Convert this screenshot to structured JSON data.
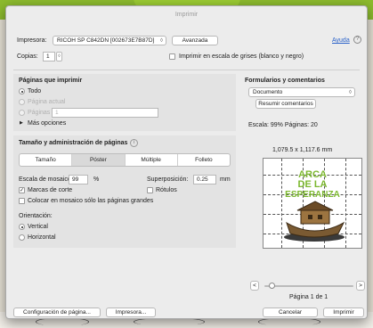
{
  "window": {
    "title": "Imprimir"
  },
  "printer": {
    "label": "Impresora:",
    "value": "RICOH SP C842DN [002673E7B87D]",
    "advanced_label": "Avanzada",
    "help_label": "Ayuda"
  },
  "copies": {
    "label": "Copias:",
    "value": "1",
    "grayscale_label": "Imprimir en escala de grises (blanco y negro)"
  },
  "pages": {
    "title": "Páginas que imprimir",
    "all_label": "Todo",
    "current_label": "Página actual",
    "range_label": "Páginas",
    "range_value": "1",
    "more_label": "Más opciones"
  },
  "forms": {
    "title": "Formularios y comentarios",
    "select_value": "Documento",
    "summary_button": "Resumir comentarios"
  },
  "scale_info": {
    "text": "Escala:  99%  Páginas: 20"
  },
  "size": {
    "title": "Tamaño y administración de páginas",
    "tabs": [
      "Tamaño",
      "Póster",
      "Múltiple",
      "Folleto"
    ],
    "active_tab": "Póster",
    "tile_scale_label": "Escala de mosaico:",
    "tile_scale_value": "99",
    "tile_scale_unit": "%",
    "overlap_label": "Superposición:",
    "overlap_value": "0.25",
    "overlap_unit": "mm",
    "cut_marks_label": "Marcas de corte",
    "labels_label": "Rótulos",
    "large_pages_label": "Colocar en mosaico sólo las páginas grandes"
  },
  "orientation": {
    "title": "Orientación:",
    "vertical_label": "Vertical",
    "horizontal_label": "Horizontal"
  },
  "preview": {
    "dimensions": "1,079.5 x 1,117.6 mm",
    "line1": "ARCA",
    "line2": "DE LA",
    "line3": "ESPERANZA",
    "page_label": "Página 1 de 1",
    "progress": 0.05
  },
  "footer": {
    "page_setup": "Configuración de página...",
    "print_to": "Impresora...",
    "cancel": "Cancelar",
    "print": "Imprimir"
  },
  "colors": {
    "accent": "#2a62c9",
    "title_green": "#7cb82f",
    "boat": "#7a5a32"
  }
}
